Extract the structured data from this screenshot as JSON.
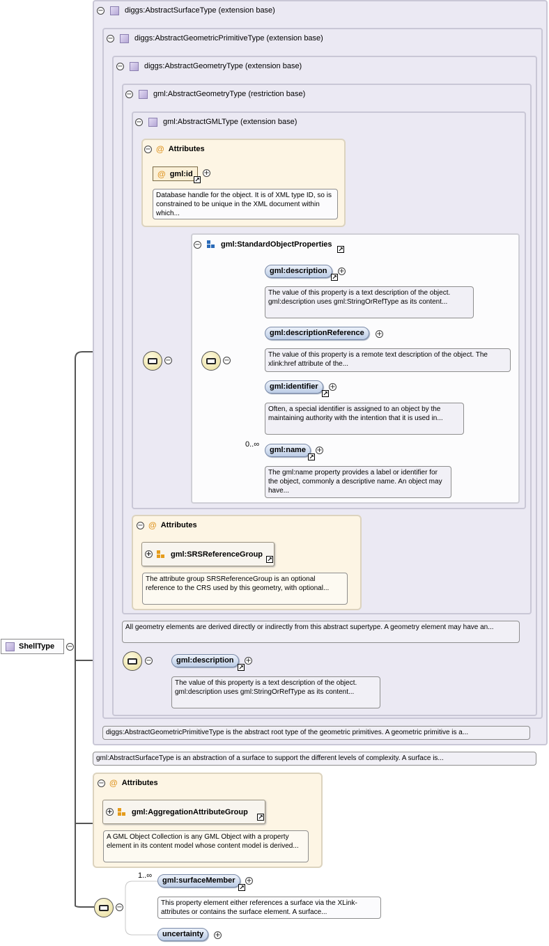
{
  "root": {
    "label": "ShellType"
  },
  "nested_types": [
    {
      "title": "diggs:AbstractSurfaceType (extension base)"
    },
    {
      "title": "diggs:AbstractGeometricPrimitiveType (extension base)"
    },
    {
      "title": "diggs:AbstractGeometryType (extension base)"
    },
    {
      "title": "gml:AbstractGeometryType (restriction base)"
    },
    {
      "title": "gml:AbstractGMLType (extension base)"
    }
  ],
  "gml_attributes": {
    "title": "Attributes",
    "id_label": "gml:id",
    "id_doc": "Database handle for the object. It is of XML type ID, so is constrained to be unique in the XML document within which..."
  },
  "standard_object_properties": {
    "title": "gml:StandardObjectProperties",
    "elements": [
      {
        "label": "gml:description",
        "doc": "The value of this property is a text description of the object. gml:description uses gml:StringOrRefType as its content...",
        "cardinality": ""
      },
      {
        "label": "gml:descriptionReference",
        "doc": "The value of this property is a remote text description of the object. The xlink:href attribute of the...",
        "cardinality": ""
      },
      {
        "label": "gml:identifier",
        "doc": "Often, a special identifier is assigned to an object by the maintaining authority with the intention that it is used in...",
        "cardinality": ""
      },
      {
        "label": "gml:name",
        "doc": "The gml:name property provides a label or identifier for the object, commonly a descriptive name. An object may have...",
        "cardinality": "0..∞"
      }
    ]
  },
  "srs_attributes": {
    "title": "Attributes",
    "group_label": "gml:SRSReferenceGroup",
    "group_doc": "The attribute group SRSReferenceGroup is an optional reference to the CRS used by this geometry, with optional..."
  },
  "geometry_doc": "All geometry elements are derived directly or indirectly from this abstract supertype. A geometry element may have an...",
  "diggs_description": {
    "label": "gml:description",
    "doc": "The value of this property is a text description of the object. gml:description uses gml:StringOrRefType as its content..."
  },
  "primitive_doc": "diggs:AbstractGeometricPrimitiveType is the abstract root type of the geometric primitives. A geometric primitive is a...",
  "surface_doc": "gml:AbstractSurfaceType is an abstraction of a surface to support the different levels of complexity. A surface is...",
  "shell_attributes": {
    "title": "Attributes",
    "group_label": "gml:AggregationAttributeGroup",
    "group_doc": "A GML Object Collection is any GML Object with a property element in its content model whose content model is derived..."
  },
  "shell_sequence": [
    {
      "label": "gml:surfaceMember",
      "cardinality": "1..∞",
      "doc": "This property element either references a surface via the XLink-attributes or contains the surface element. A surface..."
    },
    {
      "label": "uncertainty",
      "cardinality": "",
      "doc": ""
    }
  ],
  "glyphs": {
    "collapse": "⊖",
    "expand": "⊕",
    "link": "↗",
    "attribute": "@"
  }
}
